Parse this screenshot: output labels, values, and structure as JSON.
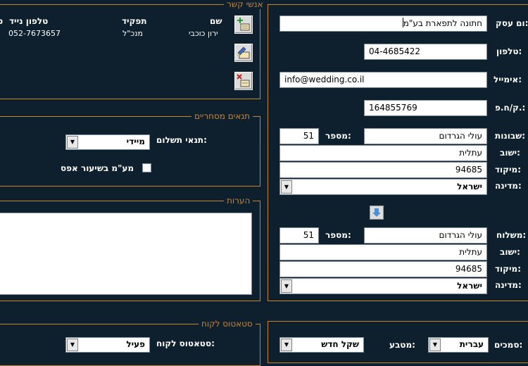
{
  "business": {
    "name_label": "ום עסק:",
    "name_value": "חתונה לתפארת בע\"מ",
    "phone_label": "טלפון:",
    "phone_value": "04-4685422",
    "email_label": "אימייל:",
    "email_value": "info@wedding.co.il",
    "id_label": "ק/ח.פ.:",
    "id_value": "164855769"
  },
  "billing_address": {
    "street_label": "שבונות:",
    "street_value": "עולי הגרדום",
    "number_label": "מספר:",
    "number_value": "51",
    "city_label": "ישוב:",
    "city_value": "עתלית",
    "zip_label": "מיקוד:",
    "zip_value": "94685",
    "country_label": "מדינה:",
    "country_value": "ישראל"
  },
  "shipping_address": {
    "street_label": "משלוח:",
    "street_value": "עולי הגרדום",
    "number_label": "מספר:",
    "number_value": "51",
    "city_label": "ישוב:",
    "city_value": "עתלית",
    "zip_label": "מיקוד:",
    "zip_value": "94685",
    "country_label": "מדינה:",
    "country_value": "ישראל"
  },
  "contacts": {
    "legend": "אנשי קשר",
    "headers": {
      "name": "שם",
      "role": "תפקיד",
      "mobile": "טלפון נייד",
      "extra": "ט"
    },
    "rows": [
      {
        "name": "ירון כוכבי",
        "role": "מנכ\"ל",
        "mobile": "052-7673657"
      }
    ]
  },
  "terms": {
    "legend": "תנאים מסחריים",
    "payment_label": "תנאי תשלום:",
    "payment_value": "מיידי",
    "vat_label": "מע\"מ בשיעור אפס"
  },
  "notes": {
    "legend": "הערות"
  },
  "status": {
    "legend": "סטאטוס לקוח",
    "status_label": "סטאטוס לקוח:",
    "status_value": "פעיל"
  },
  "documents": {
    "label": "סמכים:",
    "language_value": "עברית",
    "currency_label": "מטבע:",
    "currency_value": "שקל חדש"
  },
  "colors": {
    "background": "#0e1f2e",
    "accent": "#c8862c"
  }
}
